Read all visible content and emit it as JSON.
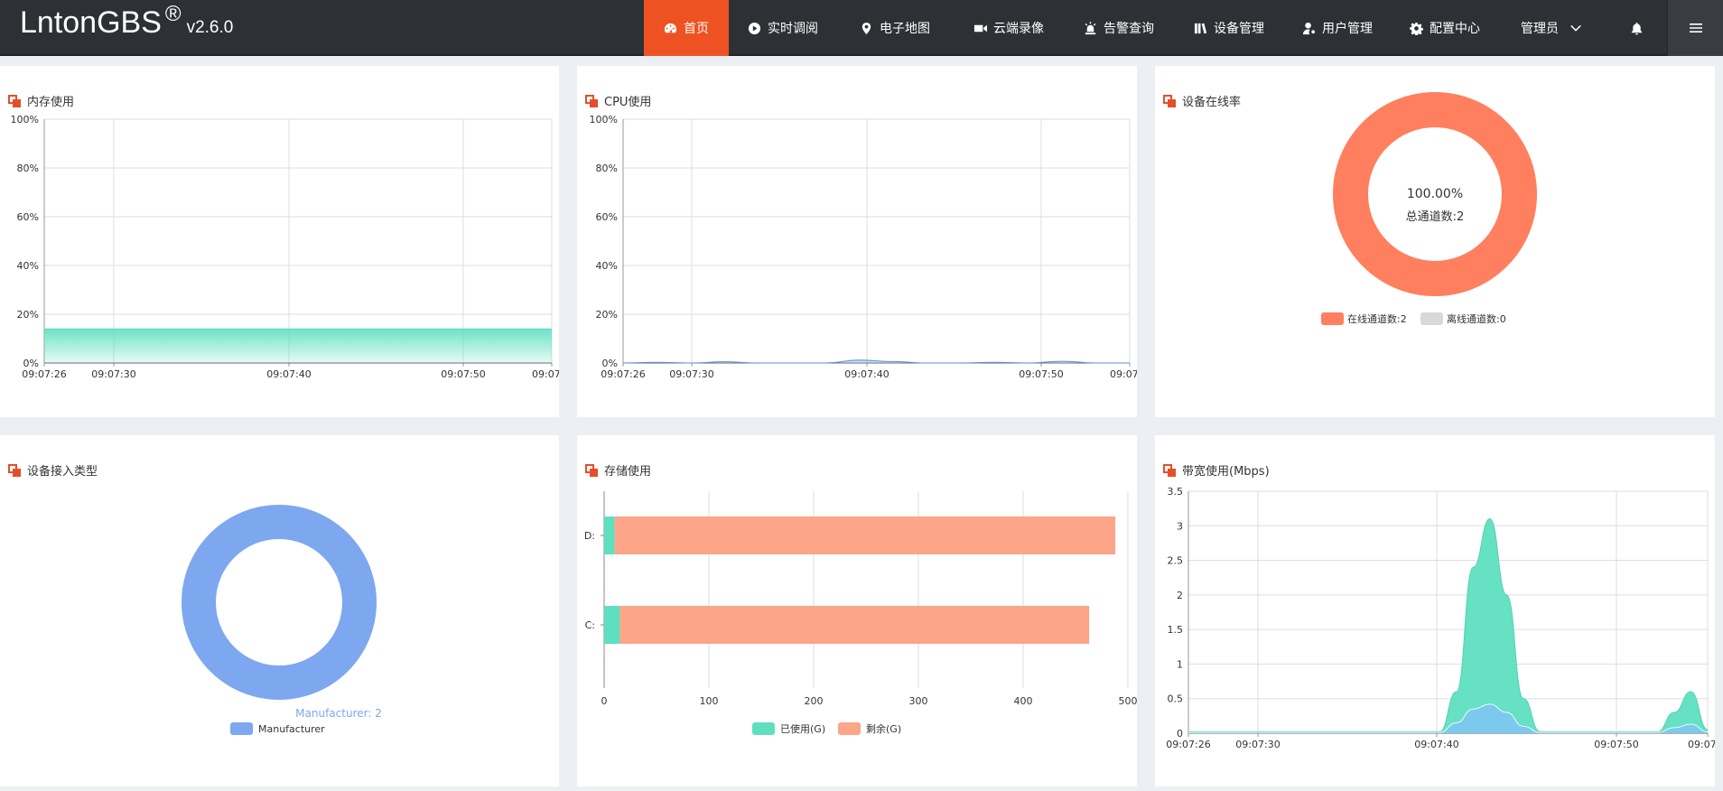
{
  "brand": {
    "name": "LntonGBS",
    "reg": "®",
    "version": "v2.6.0"
  },
  "nav": {
    "home": "首页",
    "live": "实时调阅",
    "map": "电子地图",
    "cloud": "云端录像",
    "alarm": "告警查询",
    "device": "设备管理",
    "user": "用户管理",
    "config": "配置中心",
    "admin": "管理员"
  },
  "colors": {
    "accent": "#ef5222",
    "topbar": "#2d3035",
    "teal": "#5edfc0",
    "salmon": "#ff7f5e",
    "peach": "#fca588",
    "blue": "#7da7ef"
  },
  "panels": {
    "memory": {
      "title": "内存使用",
      "chart_data": {
        "type": "area",
        "y_ticks": [
          "100%",
          "80%",
          "60%",
          "40%",
          "20%",
          "0%"
        ],
        "x_ticks": [
          "09:07:26",
          "09:07:30",
          "09:07:40",
          "09:07:50",
          "09:07:"
        ],
        "ylim": [
          0,
          100
        ],
        "series": [
          {
            "values": [
              14,
              14,
              14,
              14,
              14,
              14,
              14,
              14,
              14,
              14
            ]
          }
        ]
      }
    },
    "cpu": {
      "title": "CPU使用",
      "chart_data": {
        "type": "area",
        "y_ticks": [
          "100%",
          "80%",
          "60%",
          "40%",
          "20%",
          "0%"
        ],
        "x_ticks": [
          "09:07:26",
          "09:07:30",
          "09:07:40",
          "09:07:50",
          "09:07:"
        ],
        "ylim": [
          0,
          100
        ],
        "series": [
          {
            "values": [
              0,
              0.3,
              0,
              0.5,
              0,
              0,
              0,
              1.2,
              0.6,
              0,
              0,
              0.3,
              0,
              0.7,
              0,
              0
            ]
          }
        ]
      }
    },
    "online": {
      "title": "设备在线率",
      "center_pct": "100.00%",
      "center_total": "总通道数:2",
      "chart_data": {
        "type": "pie",
        "slices": [
          {
            "name": "在线通道数:2",
            "value": 2,
            "color": "#ff7f5e"
          },
          {
            "name": "离线通道数:0",
            "value": 0,
            "color": "#d9d9d9"
          }
        ]
      }
    },
    "access": {
      "title": "设备接入类型",
      "slice_label": "Manufacturer: 2",
      "legend": "Manufacturer",
      "chart_data": {
        "type": "pie",
        "slices": [
          {
            "name": "Manufacturer",
            "value": 2,
            "color": "#7da7ef"
          }
        ]
      }
    },
    "storage": {
      "title": "存储使用",
      "legend_used": "已使用(G)",
      "legend_free": "剩余(G)",
      "chart_data": {
        "type": "bar",
        "orientation": "horizontal",
        "stacked": true,
        "categories": [
          "D:",
          "C:"
        ],
        "x_ticks": [
          "0",
          "100",
          "200",
          "300",
          "400",
          "500"
        ],
        "xlim": [
          0,
          500
        ],
        "series": [
          {
            "name": "已使用(G)",
            "values": [
              10,
              15
            ]
          },
          {
            "name": "剩余(G)",
            "values": [
              478,
              448
            ]
          }
        ]
      }
    },
    "bandwidth": {
      "title": "带宽使用(Mbps)",
      "chart_data": {
        "type": "area",
        "y_ticks": [
          "3.5",
          "3",
          "2.5",
          "2",
          "1.5",
          "1",
          "0.5",
          "0"
        ],
        "x_ticks": [
          "09:07:26",
          "09:07:30",
          "09:07:40",
          "09:07:50",
          "09:07:"
        ],
        "ylim": [
          0,
          3.5
        ],
        "series": [
          {
            "values": [
              0.02,
              0.02,
              0.02,
              0.02,
              0.02,
              0.02,
              0.02,
              0.02,
              0.02,
              0.02,
              0.02,
              0.02,
              0.02,
              0.02,
              0.02,
              0.02,
              0.6,
              2.4,
              3.1,
              2.0,
              0.5,
              0.02,
              0.02,
              0.02,
              0.02,
              0.02,
              0.02,
              0.02,
              0.02,
              0.3,
              0.6,
              0.05
            ]
          },
          {
            "values": [
              0.01,
              0.01,
              0.01,
              0.01,
              0.01,
              0.01,
              0.01,
              0.01,
              0.01,
              0.01,
              0.01,
              0.01,
              0.01,
              0.01,
              0.01,
              0.01,
              0.15,
              0.35,
              0.42,
              0.3,
              0.1,
              0.01,
              0.01,
              0.01,
              0.01,
              0.01,
              0.01,
              0.01,
              0.01,
              0.08,
              0.13,
              0.02
            ]
          }
        ]
      }
    }
  }
}
